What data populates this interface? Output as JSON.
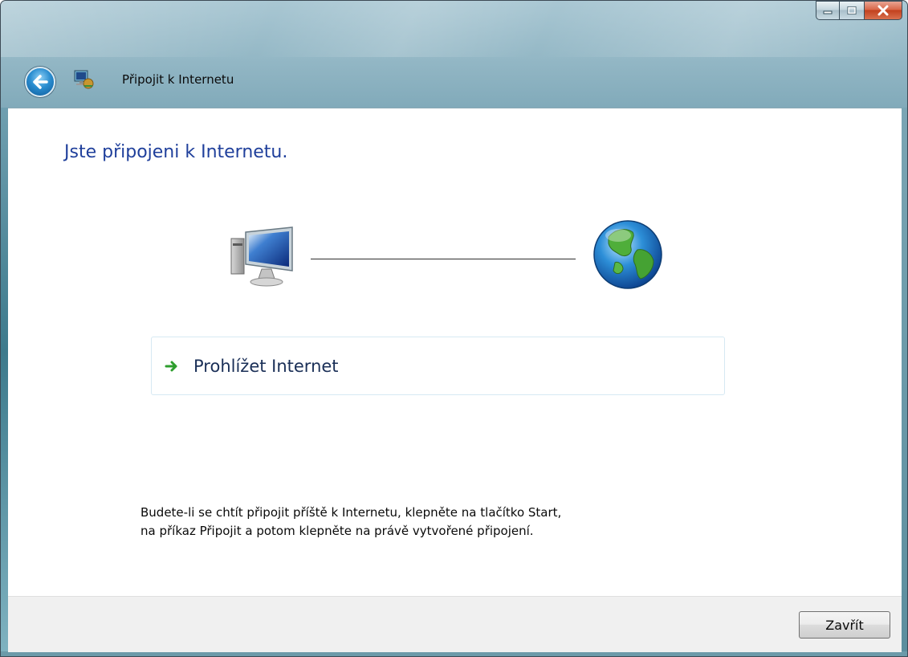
{
  "window": {
    "title": "Připojit k Internetu",
    "caption_buttons": [
      "minimize",
      "maximize",
      "close"
    ]
  },
  "content": {
    "heading": "Jste připojeni k Internetu.",
    "diagram": {
      "left_icon": "computer-icon",
      "right_icon": "globe-icon",
      "connection": "connected"
    },
    "action": {
      "icon": "green-arrow-icon",
      "label": "Prohlížet Internet"
    },
    "footnote_line1": "Budete-li se chtít připojit příště k Internetu, klepněte na tlačítko Start,",
    "footnote_line2": "na příkaz Připojit a potom klepněte na právě vytvořené připojení."
  },
  "footer": {
    "close_label": "Zavřít"
  },
  "colors": {
    "heading": "#1f3f9b",
    "action_text": "#1a2f57",
    "arrow": "#2e9e2e"
  }
}
